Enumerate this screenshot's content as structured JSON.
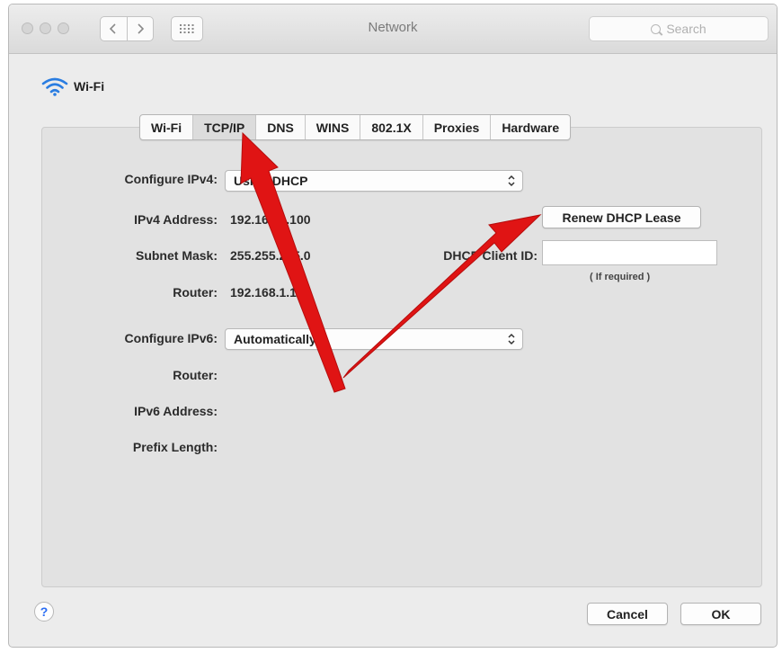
{
  "window": {
    "title": "Network"
  },
  "toolbar": {
    "search_placeholder": "Search"
  },
  "interface": {
    "name": "Wi-Fi"
  },
  "tabs": [
    {
      "label": "Wi-Fi",
      "active": false
    },
    {
      "label": "TCP/IP",
      "active": true
    },
    {
      "label": "DNS",
      "active": false
    },
    {
      "label": "WINS",
      "active": false
    },
    {
      "label": "802.1X",
      "active": false
    },
    {
      "label": "Proxies",
      "active": false
    },
    {
      "label": "Hardware",
      "active": false
    }
  ],
  "ipv4": {
    "configure_label": "Configure IPv4:",
    "configure_value": "Using DHCP",
    "address_label": "IPv4 Address:",
    "address_value": "192.168.1.100",
    "subnet_label": "Subnet Mask:",
    "subnet_value": "255.255.255.0",
    "router_label": "Router:",
    "router_value": "192.168.1.1",
    "renew_button": "Renew DHCP Lease",
    "dhcp_client_id_label": "DHCP Client ID:",
    "dhcp_client_id_value": "",
    "dhcp_client_id_hint": "( If required )"
  },
  "ipv6": {
    "configure_label": "Configure IPv6:",
    "configure_value": "Automatically",
    "router_label": "Router:",
    "address_label": "IPv6 Address:",
    "prefix_label": "Prefix Length:"
  },
  "footer": {
    "help_label": "?",
    "cancel_button": "Cancel",
    "ok_button": "OK"
  },
  "colors": {
    "annotation_arrow": "#e01414",
    "wifi_icon": "#2a7de1",
    "help_icon": "#2a6df4"
  }
}
